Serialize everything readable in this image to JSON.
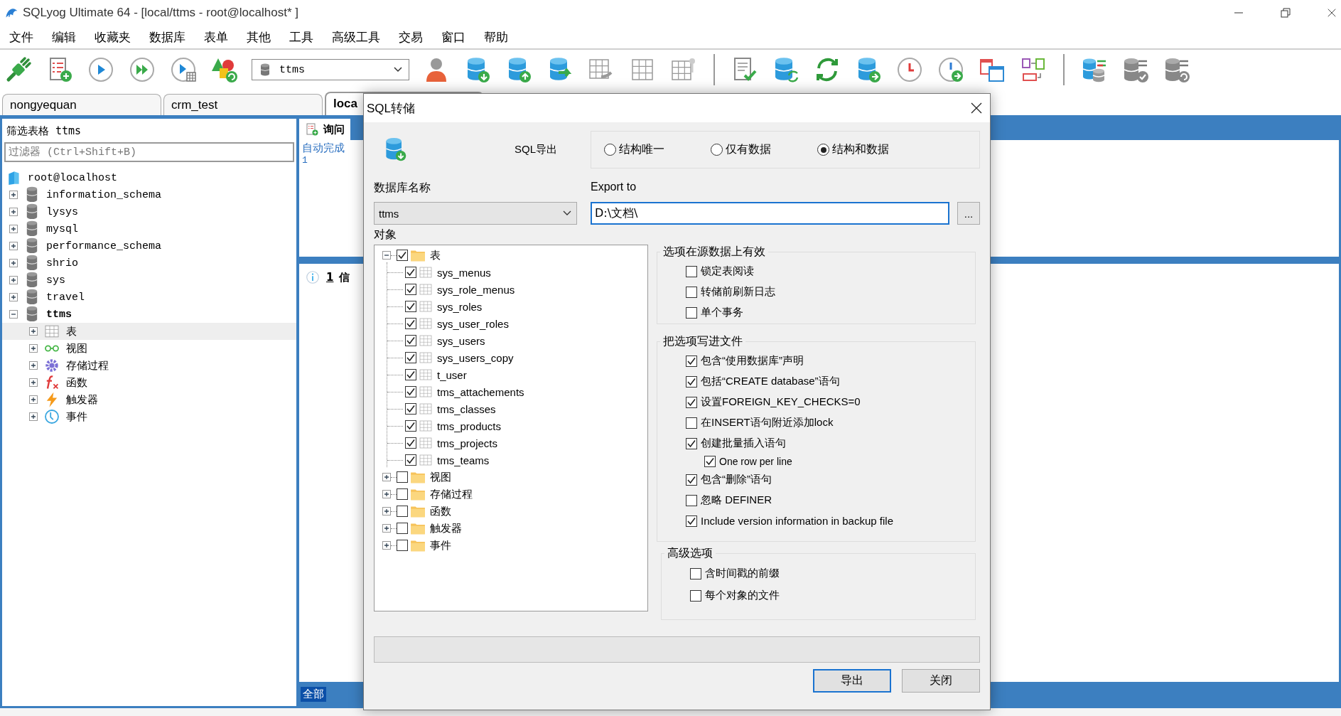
{
  "window": {
    "title": "SQLyog Ultimate 64 - [local/ttms - root@localhost* ]"
  },
  "menu": [
    "文件",
    "编辑",
    "收藏夹",
    "数据库",
    "表单",
    "其他",
    "工具",
    "高级工具",
    "交易",
    "窗口",
    "帮助"
  ],
  "toolbar": {
    "database": "ttms"
  },
  "tabs": [
    {
      "label": "nongyequan",
      "selected": false
    },
    {
      "label": "crm_test",
      "selected": false
    },
    {
      "label": "loca",
      "selected": true
    }
  ],
  "object_browser": {
    "title": "筛选表格 ttms",
    "filter_placeholder": "过滤器 (Ctrl+Shift+B)",
    "tree": {
      "label": "root@localhost",
      "children": [
        {
          "label": "information_schema",
          "kind": "database",
          "expanded": false,
          "current": false,
          "selected": false
        },
        {
          "label": "lysys",
          "kind": "database",
          "expanded": false,
          "current": false,
          "selected": false
        },
        {
          "label": "mysql",
          "kind": "database",
          "expanded": false,
          "current": false,
          "selected": false
        },
        {
          "label": "performance_schema",
          "kind": "database",
          "expanded": false,
          "current": false,
          "selected": false
        },
        {
          "label": "shrio",
          "kind": "database",
          "expanded": false,
          "current": false,
          "selected": false
        },
        {
          "label": "sys",
          "kind": "database",
          "expanded": false,
          "current": false,
          "selected": false
        },
        {
          "label": "travel",
          "kind": "database",
          "expanded": false,
          "current": false,
          "selected": false
        },
        {
          "label": "ttms",
          "kind": "database",
          "expanded": true,
          "current": true,
          "selected": false,
          "children": [
            {
              "label": "表",
              "kind": "tables",
              "expanded": false,
              "selected": true
            },
            {
              "label": "视图",
              "kind": "views",
              "expanded": false,
              "selected": false
            },
            {
              "label": "存储过程",
              "kind": "procedures",
              "expanded": false,
              "selected": false
            },
            {
              "label": "函数",
              "kind": "functions",
              "expanded": false,
              "selected": false
            },
            {
              "label": "触发器",
              "kind": "triggers",
              "expanded": false,
              "selected": false
            },
            {
              "label": "事件",
              "kind": "events",
              "expanded": false,
              "selected": false
            }
          ]
        }
      ]
    }
  },
  "query_panel": {
    "tab": "询问",
    "hint": "自动完成",
    "line_numbers": [
      "1"
    ],
    "messages_count": "1",
    "messages_label": "信",
    "result_filter": "全部"
  },
  "dialog": {
    "title": "SQL转储",
    "heading": "SQL导出",
    "export_modes": [
      {
        "label": "结构唯一",
        "selected": false
      },
      {
        "label": "仅有数据",
        "selected": false
      },
      {
        "label": "结构和数据",
        "selected": true
      }
    ],
    "database_label": "数据库名称",
    "database": "ttms",
    "export_to_label": "Export to",
    "export_path": "D:\\文档\\",
    "browse": "...",
    "objects_label": "对象",
    "objects": [
      {
        "label": "表",
        "kind": "folder",
        "expanded": true,
        "checked": true,
        "children": [
          {
            "label": "sys_menus",
            "kind": "table",
            "checked": true
          },
          {
            "label": "sys_role_menus",
            "kind": "table",
            "checked": true
          },
          {
            "label": "sys_roles",
            "kind": "table",
            "checked": true
          },
          {
            "label": "sys_user_roles",
            "kind": "table",
            "checked": true
          },
          {
            "label": "sys_users",
            "kind": "table",
            "checked": true
          },
          {
            "label": "sys_users_copy",
            "kind": "table",
            "checked": true
          },
          {
            "label": "t_user",
            "kind": "table",
            "checked": true
          },
          {
            "label": "tms_attachements",
            "kind": "table",
            "checked": true
          },
          {
            "label": "tms_classes",
            "kind": "table",
            "checked": true
          },
          {
            "label": "tms_products",
            "kind": "table",
            "checked": true
          },
          {
            "label": "tms_projects",
            "kind": "table",
            "checked": true
          },
          {
            "label": "tms_teams",
            "kind": "table",
            "checked": true
          }
        ]
      },
      {
        "label": "视图",
        "kind": "folder",
        "expanded": false,
        "checked": false
      },
      {
        "label": "存储过程",
        "kind": "folder",
        "expanded": false,
        "checked": false
      },
      {
        "label": "函数",
        "kind": "folder",
        "expanded": false,
        "checked": false
      },
      {
        "label": "触发器",
        "kind": "folder",
        "expanded": false,
        "checked": false
      },
      {
        "label": "事件",
        "kind": "folder",
        "expanded": false,
        "checked": false
      }
    ],
    "option_groups": [
      {
        "title": "选项在源数据上有效",
        "options": [
          {
            "label": "锁定表阅读",
            "checked": false
          },
          {
            "label": "转储前刷新日志",
            "checked": false
          },
          {
            "label": "单个事务",
            "checked": false
          }
        ]
      },
      {
        "title": "把选项写进文件",
        "options": [
          {
            "label": "包含“使用数据库”声明",
            "checked": true
          },
          {
            "label": "包括“CREATE database”语句",
            "checked": true
          },
          {
            "label": "设置FOREIGN_KEY_CHECKS=0",
            "checked": true
          },
          {
            "label": "在INSERT语句附近添加lock",
            "checked": false
          },
          {
            "label": "创建批量插入语句",
            "checked": true,
            "children": [
              {
                "label": "One row per line",
                "checked": true
              }
            ]
          },
          {
            "label": "包含“删除”语句",
            "checked": true
          },
          {
            "label": "忽略 DEFINER",
            "checked": false
          },
          {
            "label": "Include version information in backup file",
            "checked": true
          }
        ]
      },
      {
        "title": "高级选项",
        "options": [
          {
            "label": "含时间戳的前缀",
            "checked": false
          },
          {
            "label": "每个对象的文件",
            "checked": false
          }
        ]
      }
    ],
    "progress": {
      "level": 0
    },
    "buttons": [
      {
        "label": "导出",
        "default": true
      },
      {
        "label": "关闭",
        "default": false
      }
    ]
  }
}
